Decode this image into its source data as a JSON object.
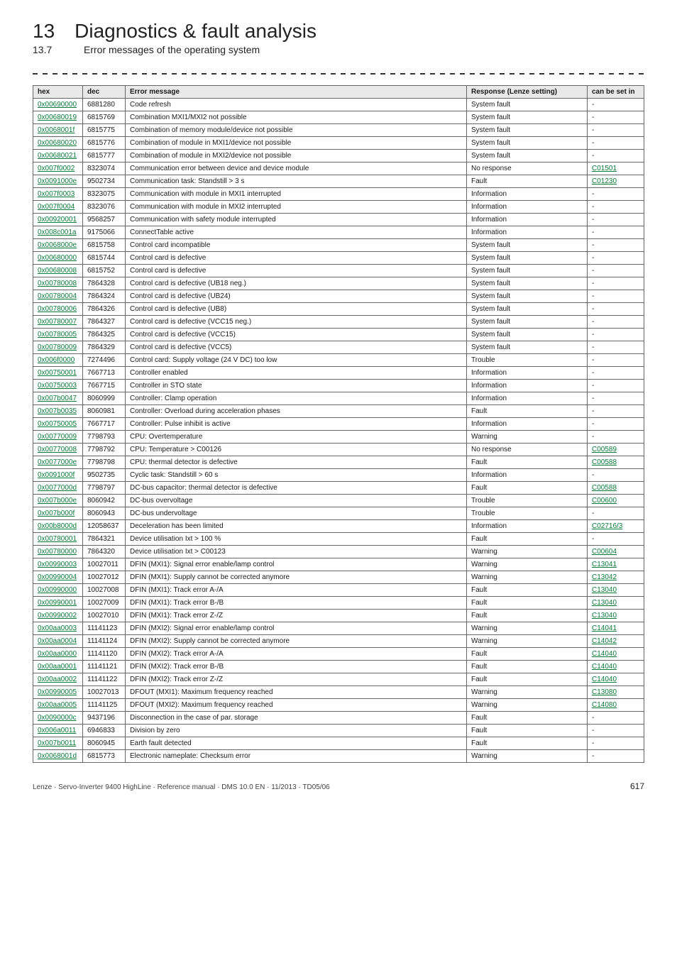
{
  "header": {
    "chapter_num": "13",
    "chapter_title": "Diagnostics & fault analysis",
    "section_num": "13.7",
    "section_title": "Error messages of the operating system"
  },
  "table": {
    "headers": {
      "hex": "hex",
      "dec": "dec",
      "msg": "Error message",
      "resp": "Response (Lenze setting)",
      "set": "can be set in"
    },
    "rows": [
      {
        "hex": "0x00690000",
        "dec": "6881280",
        "msg": "Code refresh",
        "resp": "System fault",
        "set": "-"
      },
      {
        "hex": "0x00680019",
        "dec": "6815769",
        "msg": "Combination MXI1/MXI2 not possible",
        "resp": "System fault",
        "set": "-"
      },
      {
        "hex": "0x0068001f",
        "dec": "6815775",
        "msg": "Combination of memory module/device not possible",
        "resp": "System fault",
        "set": "-"
      },
      {
        "hex": "0x00680020",
        "dec": "6815776",
        "msg": "Combination of module in MXI1/device not possible",
        "resp": "System fault",
        "set": "-"
      },
      {
        "hex": "0x00680021",
        "dec": "6815777",
        "msg": "Combination of module in MXI2/device not possible",
        "resp": "System fault",
        "set": "-"
      },
      {
        "hex": "0x007f0002",
        "dec": "8323074",
        "msg": "Communication error between device and device module",
        "resp": "No response",
        "set": "C01501",
        "setlink": true
      },
      {
        "hex": "0x0091000e",
        "dec": "9502734",
        "msg": "Communication task: Standstill > 3 s",
        "resp": "Fault",
        "set": "C01230",
        "setlink": true
      },
      {
        "hex": "0x007f0003",
        "dec": "8323075",
        "msg": "Communication with module in MXI1 interrupted",
        "resp": "Information",
        "set": "-"
      },
      {
        "hex": "0x007f0004",
        "dec": "8323076",
        "msg": "Communication with module in MXI2 interrupted",
        "resp": "Information",
        "set": "-"
      },
      {
        "hex": "0x00920001",
        "dec": "9568257",
        "msg": "Communication with safety module interrupted",
        "resp": "Information",
        "set": "-"
      },
      {
        "hex": "0x008c001a",
        "dec": "9175066",
        "msg": "ConnectTable active",
        "resp": "Information",
        "set": "-"
      },
      {
        "hex": "0x0068000e",
        "dec": "6815758",
        "msg": "Control card incompatible",
        "resp": "System fault",
        "set": "-"
      },
      {
        "hex": "0x00680000",
        "dec": "6815744",
        "msg": "Control card is defective",
        "resp": "System fault",
        "set": "-"
      },
      {
        "hex": "0x00680008",
        "dec": "6815752",
        "msg": "Control card is defective",
        "resp": "System fault",
        "set": "-"
      },
      {
        "hex": "0x00780008",
        "dec": "7864328",
        "msg": "Control card is defective (UB18 neg.)",
        "resp": "System fault",
        "set": "-"
      },
      {
        "hex": "0x00780004",
        "dec": "7864324",
        "msg": "Control card is defective (UB24)",
        "resp": "System fault",
        "set": "-"
      },
      {
        "hex": "0x00780006",
        "dec": "7864326",
        "msg": "Control card is defective (UB8)",
        "resp": "System fault",
        "set": "-"
      },
      {
        "hex": "0x00780007",
        "dec": "7864327",
        "msg": "Control card is defective (VCC15 neg.)",
        "resp": "System fault",
        "set": "-"
      },
      {
        "hex": "0x00780005",
        "dec": "7864325",
        "msg": "Control card is defective (VCC15)",
        "resp": "System fault",
        "set": "-"
      },
      {
        "hex": "0x00780009",
        "dec": "7864329",
        "msg": "Control card is defective (VCC5)",
        "resp": "System fault",
        "set": "-"
      },
      {
        "hex": "0x006f0000",
        "dec": "7274496",
        "msg": "Control card: Supply voltage (24 V DC) too low",
        "resp": "Trouble",
        "set": "-"
      },
      {
        "hex": "0x00750001",
        "dec": "7667713",
        "msg": "Controller enabled",
        "resp": "Information",
        "set": "-"
      },
      {
        "hex": "0x00750003",
        "dec": "7667715",
        "msg": "Controller in STO state",
        "resp": "Information",
        "set": "-"
      },
      {
        "hex": "0x007b0047",
        "dec": "8060999",
        "msg": "Controller: Clamp operation",
        "resp": "Information",
        "set": "-"
      },
      {
        "hex": "0x007b0035",
        "dec": "8060981",
        "msg": "Controller: Overload during acceleration phases",
        "resp": "Fault",
        "set": "-"
      },
      {
        "hex": "0x00750005",
        "dec": "7667717",
        "msg": "Controller: Pulse inhibit is active",
        "resp": "Information",
        "set": "-"
      },
      {
        "hex": "0x00770009",
        "dec": "7798793",
        "msg": "CPU: Overtemperature",
        "resp": "Warning",
        "set": "-"
      },
      {
        "hex": "0x00770008",
        "dec": "7798792",
        "msg": "CPU: Temperature > C00126",
        "resp": "No response",
        "set": "C00589",
        "setlink": true
      },
      {
        "hex": "0x0077000e",
        "dec": "7798798",
        "msg": "CPU: thermal detector is defective",
        "resp": "Fault",
        "set": "C00588",
        "setlink": true
      },
      {
        "hex": "0x0091000f",
        "dec": "9502735",
        "msg": "Cyclic task: Standstill > 60 s",
        "resp": "Information",
        "set": "-"
      },
      {
        "hex": "0x0077000d",
        "dec": "7798797",
        "msg": "DC-bus capacitor: thermal detector is defective",
        "resp": "Fault",
        "set": "C00588",
        "setlink": true
      },
      {
        "hex": "0x007b000e",
        "dec": "8060942",
        "msg": "DC-bus overvoltage",
        "resp": "Trouble",
        "set": "C00600",
        "setlink": true
      },
      {
        "hex": "0x007b000f",
        "dec": "8060943",
        "msg": "DC-bus undervoltage",
        "resp": "Trouble",
        "set": "-"
      },
      {
        "hex": "0x00b8000d",
        "dec": "12058637",
        "msg": "Deceleration has been limited",
        "resp": "Information",
        "set": "C02716/3",
        "setlink": true
      },
      {
        "hex": "0x00780001",
        "dec": "7864321",
        "msg": "Device utilisation Ixt > 100 %",
        "resp": "Fault",
        "set": "-"
      },
      {
        "hex": "0x00780000",
        "dec": "7864320",
        "msg": "Device utilisation Ixt > C00123",
        "resp": "Warning",
        "set": "C00604",
        "setlink": true
      },
      {
        "hex": "0x00990003",
        "dec": "10027011",
        "msg": "DFIN (MXI1): Signal error enable/lamp control",
        "resp": "Warning",
        "set": "C13041",
        "setlink": true
      },
      {
        "hex": "0x00990004",
        "dec": "10027012",
        "msg": "DFIN (MXI1): Supply cannot be corrected anymore",
        "resp": "Warning",
        "set": "C13042",
        "setlink": true
      },
      {
        "hex": "0x00990000",
        "dec": "10027008",
        "msg": "DFIN (MXI1): Track error A-/A",
        "resp": "Fault",
        "set": "C13040",
        "setlink": true
      },
      {
        "hex": "0x00990001",
        "dec": "10027009",
        "msg": "DFIN (MXI1): Track error B-/B",
        "resp": "Fault",
        "set": "C13040",
        "setlink": true
      },
      {
        "hex": "0x00990002",
        "dec": "10027010",
        "msg": "DFIN (MXI1): Track error Z-/Z",
        "resp": "Fault",
        "set": "C13040",
        "setlink": true
      },
      {
        "hex": "0x00aa0003",
        "dec": "11141123",
        "msg": "DFIN (MXI2): Signal error enable/lamp control",
        "resp": "Warning",
        "set": "C14041",
        "setlink": true
      },
      {
        "hex": "0x00aa0004",
        "dec": "11141124",
        "msg": "DFIN (MXI2): Supply cannot be corrected anymore",
        "resp": "Warning",
        "set": "C14042",
        "setlink": true
      },
      {
        "hex": "0x00aa0000",
        "dec": "11141120",
        "msg": "DFIN (MXI2): Track error A-/A",
        "resp": "Fault",
        "set": "C14040",
        "setlink": true
      },
      {
        "hex": "0x00aa0001",
        "dec": "11141121",
        "msg": "DFIN (MXI2): Track error B-/B",
        "resp": "Fault",
        "set": "C14040",
        "setlink": true
      },
      {
        "hex": "0x00aa0002",
        "dec": "11141122",
        "msg": "DFIN (MXI2): Track error Z-/Z",
        "resp": "Fault",
        "set": "C14040",
        "setlink": true
      },
      {
        "hex": "0x00990005",
        "dec": "10027013",
        "msg": "DFOUT (MXI1): Maximum frequency reached",
        "resp": "Warning",
        "set": "C13080",
        "setlink": true
      },
      {
        "hex": "0x00aa0005",
        "dec": "11141125",
        "msg": "DFOUT (MXI2): Maximum frequency reached",
        "resp": "Warning",
        "set": "C14080",
        "setlink": true
      },
      {
        "hex": "0x0090000c",
        "dec": "9437196",
        "msg": "Disconnection in the case of par. storage",
        "resp": "Fault",
        "set": "-"
      },
      {
        "hex": "0x006a0011",
        "dec": "6946833",
        "msg": "Division by zero",
        "resp": "Fault",
        "set": "-"
      },
      {
        "hex": "0x007b0011",
        "dec": "8060945",
        "msg": "Earth fault detected",
        "resp": "Fault",
        "set": "-"
      },
      {
        "hex": "0x0068001d",
        "dec": "6815773",
        "msg": "Electronic nameplate: Checksum error",
        "resp": "Warning",
        "set": "-"
      }
    ]
  },
  "footer": {
    "ref": "Lenze · Servo-Inverter 9400 HighLine · Reference manual · DMS 10.0 EN · 11/2013 · TD05/06",
    "page": "617"
  }
}
